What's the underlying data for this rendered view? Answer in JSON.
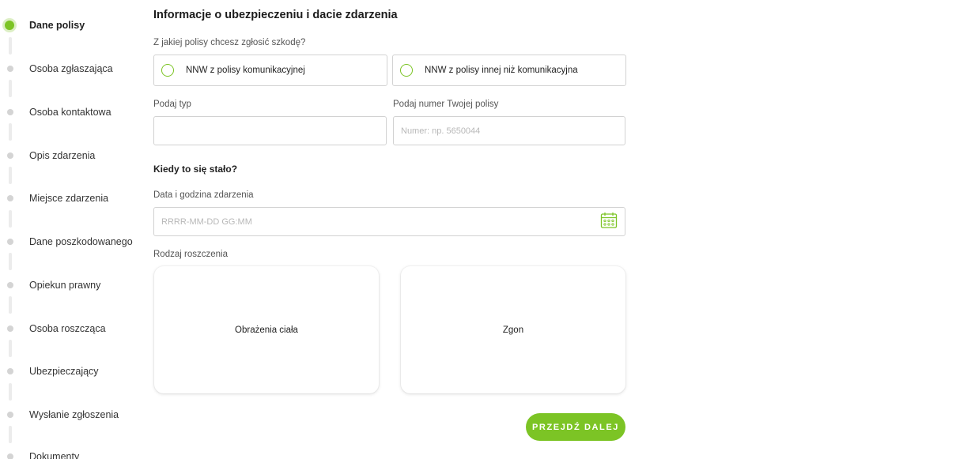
{
  "steps": [
    {
      "label": "Dane polisy",
      "active": true
    },
    {
      "label": "Osoba zgłaszająca"
    },
    {
      "label": "Osoba kontaktowa"
    },
    {
      "label": "Opis zdarzenia"
    },
    {
      "label": "Miejsce zdarzenia"
    },
    {
      "label": "Dane poszkodowanego"
    },
    {
      "label": "Opiekun prawny"
    },
    {
      "label": "Osoba roszcząca"
    },
    {
      "label": "Ubezpieczający"
    },
    {
      "label": "Wysłanie zgłoszenia"
    },
    {
      "label": "Dokumenty"
    }
  ],
  "form": {
    "title": "Informacje o ubezpieczeniu i dacie zdarzenia",
    "policy_question": "Z jakiej polisy chcesz zgłosić szkodę?",
    "policy_options": [
      "NNW z polisy komunikacyjnej",
      "NNW z polisy innej niż komunikacyjna"
    ],
    "type_label": "Podaj typ",
    "type_value": "",
    "policy_number_label": "Podaj numer Twojej polisy",
    "policy_number_placeholder": "Numer: np. 5650044",
    "when_title": "Kiedy to się stało?",
    "datetime_label": "Data i godzina zdarzenia",
    "datetime_placeholder": "RRRR-MM-DD GG:MM",
    "claim_type_label": "Rodzaj roszczenia",
    "claim_types": [
      "Obrażenia ciała",
      "Zgon"
    ],
    "next_button": "PRZEJDŹ DALEJ"
  },
  "colors": {
    "accent": "#7cc425",
    "accent_light": "#dcefc4",
    "inactive_dot": "#d4d4d4",
    "border": "#d2d2d2"
  },
  "icons": {
    "calendar": "calendar-icon",
    "radio": "radio-circle"
  }
}
